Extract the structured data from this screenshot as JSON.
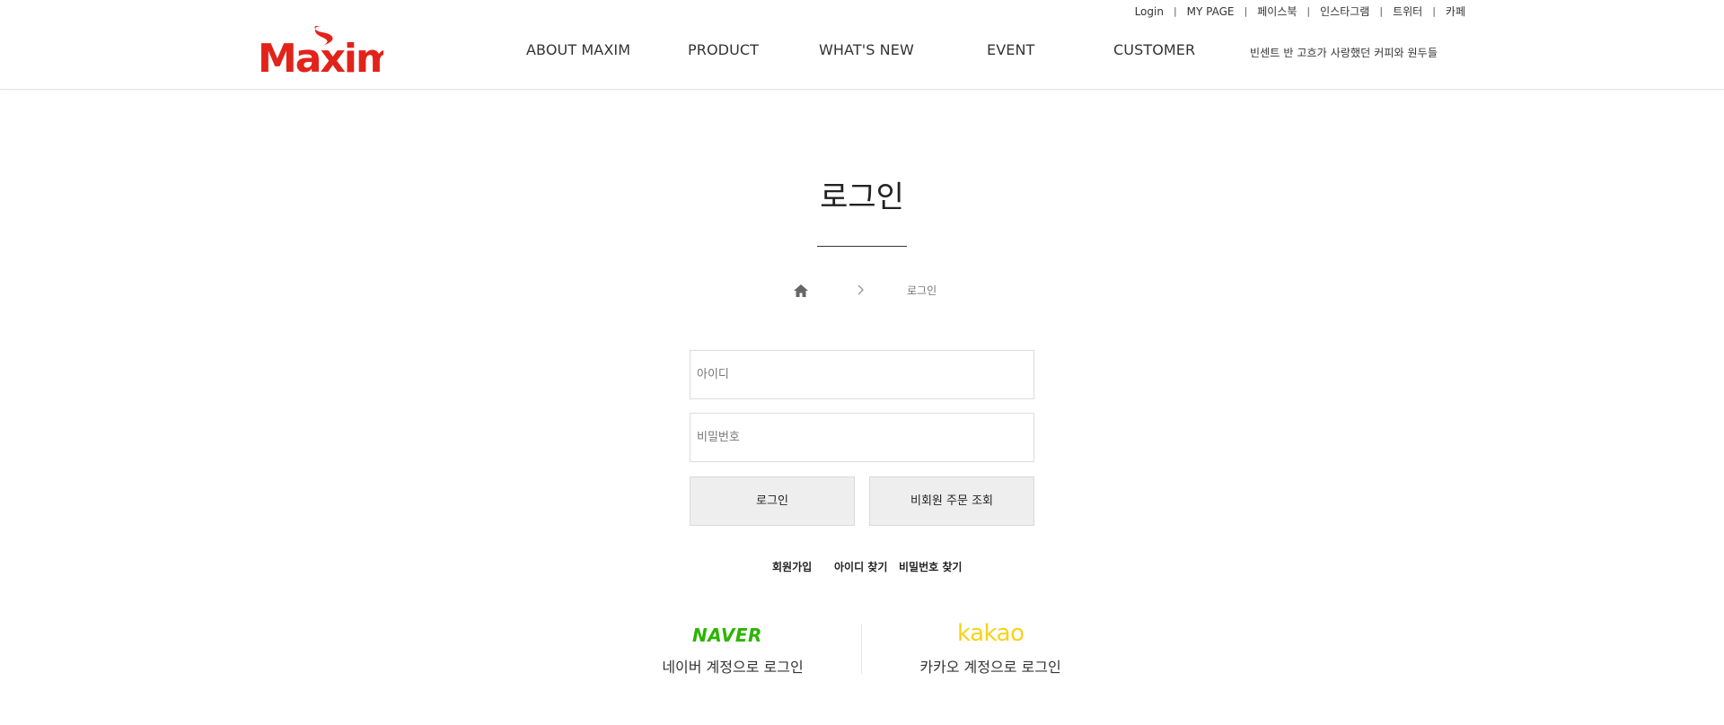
{
  "util_nav": {
    "login": "Login",
    "mypage": "MY PAGE",
    "facebook": "페이스북",
    "instagram": "인스타그램",
    "twitter": "트위터",
    "cafe": "카페",
    "separator": "|"
  },
  "logo": {
    "text": "Maxim",
    "color": "#e2231a"
  },
  "gnb": {
    "about": "ABOUT MAXIM",
    "product": "PRODUCT",
    "whats_new": "WHAT'S NEW",
    "event": "EVENT",
    "customer": "CUSTOMER",
    "promo": "빈센트 반 고흐가 사랑했던 커피와 원두들"
  },
  "page": {
    "title": "로그인"
  },
  "breadcrumb": {
    "current": "로그인"
  },
  "form": {
    "id_placeholder": "아이디",
    "pw_placeholder": "비밀번호",
    "login_button": "로그인",
    "guest_button": "비회원 주문 조회"
  },
  "links": {
    "join": "회원가입",
    "find_id": "아이디 찾기",
    "find_pw": "비밀번호 찾기"
  },
  "social": {
    "naver_logo": "NAVER",
    "naver_label": "네이버 계정으로 로그인",
    "kakao_logo": "kakao",
    "kakao_label": "카카오 계정으로 로그인"
  },
  "colors": {
    "brand_red": "#e2231a",
    "naver_green": "#2db400",
    "kakao_yellow": "#f7d31a",
    "button_bg": "#eeeeee"
  }
}
